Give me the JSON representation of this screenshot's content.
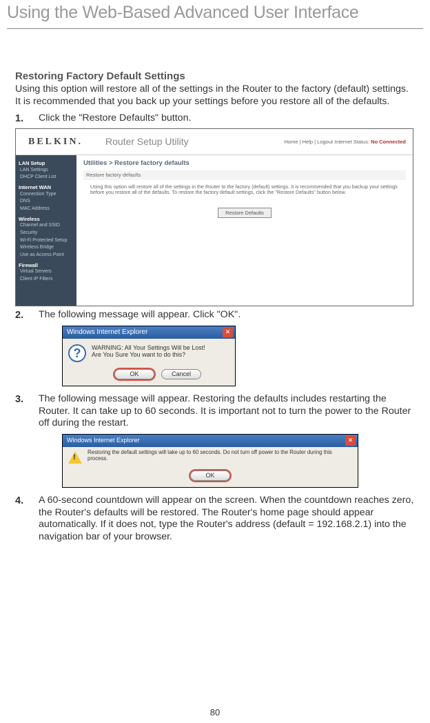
{
  "page_title": "Using the Web-Based Advanced User Interface",
  "section_heading": "Restoring Factory Default Settings",
  "intro_text": "Using this option will restore all of the settings in the Router to the factory (default) settings. It is recommended that you back up your settings before you restore all of the defaults.",
  "steps": {
    "s1": "Click the \"Restore Defaults\" button.",
    "s2": "The following message will appear. Click \"OK\".",
    "s3": "The following message will appear. Restoring the defaults includes restarting the Router. It can take up to 60 seconds. It is important not to turn the power to the Router off during the restart.",
    "s4": "A 60-second countdown will appear on the screen. When the countdown reaches zero, the Router's defaults will be restored. The Router's home page should appear automatically. If it does not, type the Router's address (default = 192.168.2.1) into the navigation bar of your browser."
  },
  "router_screenshot": {
    "brand": "BELKIN.",
    "utility_title": "Router Setup Utility",
    "header_links": "Home | Help | Logout   Internet Status:",
    "header_status": "No Connected",
    "breadcrumb": "Utilities > Restore factory defaults",
    "subheader": "Restore factory defaults",
    "description": "Using this option will restore all of the settings in the Router to the factory (default) settings. It is recommended that you backup your settings before you restore all of the defaults. To restore the factory default settings, click the \"Restore Defaults\" button below.",
    "button_label": "Restore Defaults",
    "sidebar": {
      "cats": [
        "LAN Setup",
        "Internet WAN",
        "Wireless",
        "Firewall"
      ],
      "lan": [
        "LAN Settings",
        "DHCP Client List"
      ],
      "wan": [
        "Connection Type",
        "DNS",
        "MAC Address"
      ],
      "wireless": [
        "Channel and SSID",
        "Security",
        "Wi-Fi Protected Setup",
        "Wireless Bridge",
        "Use as Access Point"
      ],
      "firewall": [
        "Virtual Servers",
        "Client IP Filters"
      ]
    }
  },
  "dialog1": {
    "title": "Windows Internet Explorer",
    "message": "WARNING: All Your Settings Will be Lost!\nAre You Sure You want to do this?",
    "ok": "OK",
    "cancel": "Cancel"
  },
  "dialog2": {
    "title": "Windows Internet Explorer",
    "message": "Restoring the default settings will take up to 60 seconds. Do not turn off power to the Router during this process.",
    "ok": "OK"
  },
  "page_number": "80"
}
